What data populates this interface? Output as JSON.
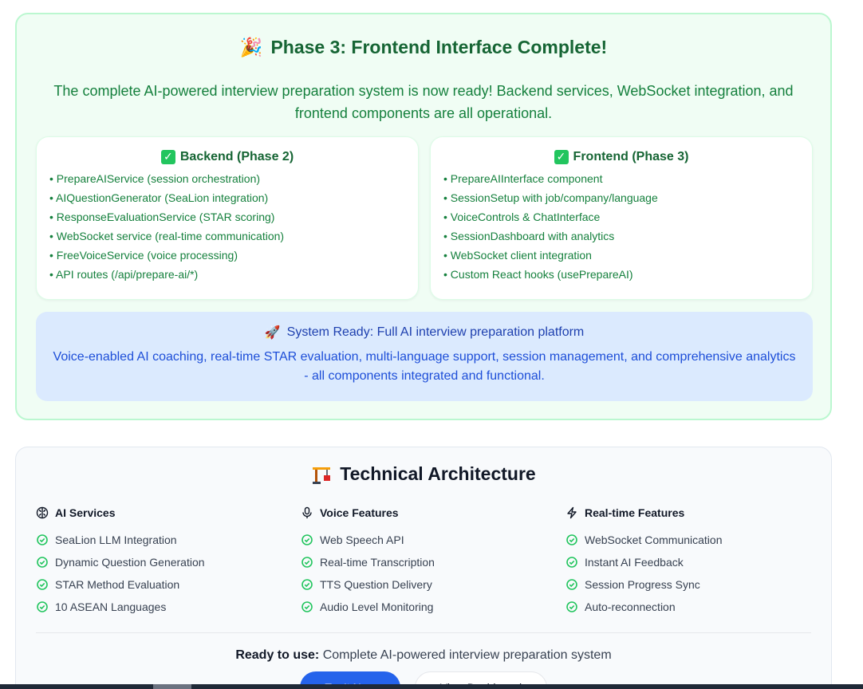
{
  "phase": {
    "icon": "party-popper-icon",
    "title": "Phase 3: Frontend Interface Complete!",
    "description": "The complete AI-powered interview preparation system is now ready! Backend services, WebSocket integration, and frontend components are all operational.",
    "backend": {
      "title": "Backend (Phase 2)",
      "items": [
        "PrepareAIService (session orchestration)",
        "AIQuestionGenerator (SeaLion integration)",
        "ResponseEvaluationService (STAR scoring)",
        "WebSocket service (real-time communication)",
        "FreeVoiceService (voice processing)",
        "API routes (/api/prepare-ai/*)"
      ]
    },
    "frontend": {
      "title": "Frontend (Phase 3)",
      "items": [
        "PrepareAIInterface component",
        "SessionSetup with job/company/language",
        "VoiceControls & ChatInterface",
        "SessionDashboard with analytics",
        "WebSocket client integration",
        "Custom React hooks (usePrepareAI)"
      ]
    },
    "ready": {
      "icon": "rocket-icon",
      "title": "System Ready: Full AI interview preparation platform",
      "description": "Voice-enabled AI coaching, real-time STAR evaluation, multi-language support, session management, and comprehensive analytics - all components integrated and functional."
    }
  },
  "architecture": {
    "icon": "construction-crane-icon",
    "title": "Technical Architecture",
    "columns": [
      {
        "icon": "brain-icon",
        "title": "AI Services",
        "items": [
          "SeaLion LLM Integration",
          "Dynamic Question Generation",
          "STAR Method Evaluation",
          "10 ASEAN Languages"
        ]
      },
      {
        "icon": "microphone-icon",
        "title": "Voice Features",
        "items": [
          "Web Speech API",
          "Real-time Transcription",
          "TTS Question Delivery",
          "Audio Level Monitoring"
        ]
      },
      {
        "icon": "lightning-icon",
        "title": "Real-time Features",
        "items": [
          "WebSocket Communication",
          "Instant AI Feedback",
          "Session Progress Sync",
          "Auto-reconnection"
        ]
      }
    ],
    "footer_bold": "Ready to use:",
    "footer_text": "Complete AI-powered interview preparation system",
    "primary_button": "Try It Now",
    "secondary_button": "View Dashboard"
  },
  "colors": {
    "green_bg": "#f0fdf4",
    "green_border": "#bbf7d0",
    "green_text": "#15803d",
    "blue_bg": "#dbeafe",
    "blue_text": "#1d4ed8",
    "primary": "#2563eb"
  }
}
